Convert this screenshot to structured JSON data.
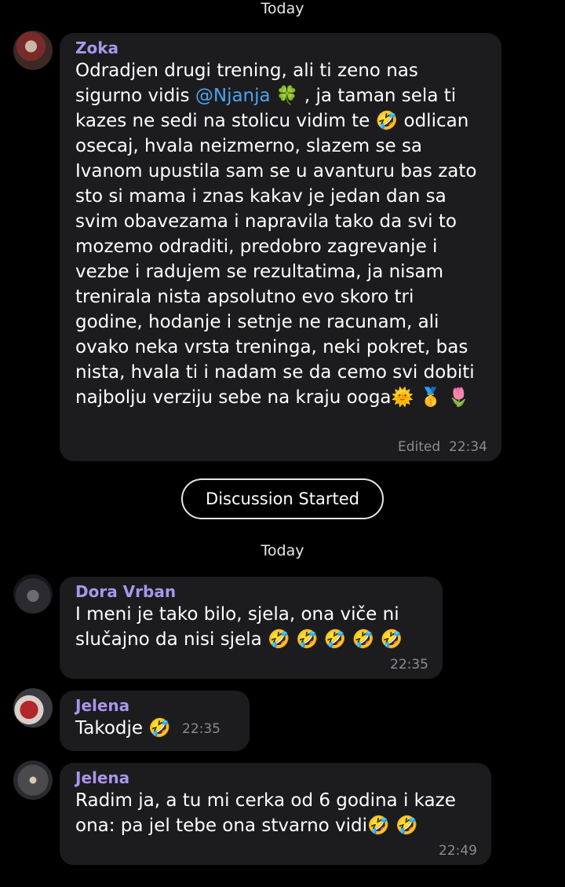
{
  "dates": {
    "top": "Today",
    "middle": "Today"
  },
  "divider": {
    "label": "Discussion Started"
  },
  "messages": [
    {
      "sender": "Zoka",
      "text_before_mention": "Odradjen drugi trening, ali ti zeno nas sigurno vidis ",
      "mention": "@Njanja",
      "text_after_mention": " 🍀 , ja taman sela ti kazes ne sedi na stolicu vidim te 🤣 odlican osecaj, hvala neizmerno, slazem se sa Ivanom upustila sam se u avanturu bas zato sto si  mama i znas kakav je jedan dan sa svim obavezama i napravila tako da svi to mozemo odraditi, predobro zagrevanje i vezbe i radujem se rezultatima, ja nisam trenirala nista apsolutno evo skoro tri godine, hodanje i setnje ne racunam, ali ovako neka vrsta treninga, neki pokret, bas nista, hvala ti i nadam se da cemo svi dobiti najbolju verziju sebe na kraju ooga🌞 🥇 🌷",
      "edited": "Edited",
      "time": "22:34"
    },
    {
      "sender": "Dora Vrban",
      "text": "I meni je tako bilo, sjela, ona viče ni slučajno da nisi sjela 🤣 🤣 🤣 🤣 🤣",
      "time": "22:35"
    },
    {
      "sender": "Jelena",
      "text": "Takodje 🤣",
      "time": "22:35"
    },
    {
      "sender": "Jelena",
      "text": "Radim ja, a tu mi cerka od 6 godina i kaze ona: pa jel tebe ona stvarno vidi🤣 🤣",
      "time": "22:49"
    }
  ],
  "colors": {
    "background": "#000000",
    "bubble": "#1c1c1e",
    "sender": "#a996ea",
    "mention": "#4fa3ef",
    "meta": "#8b8b90"
  }
}
